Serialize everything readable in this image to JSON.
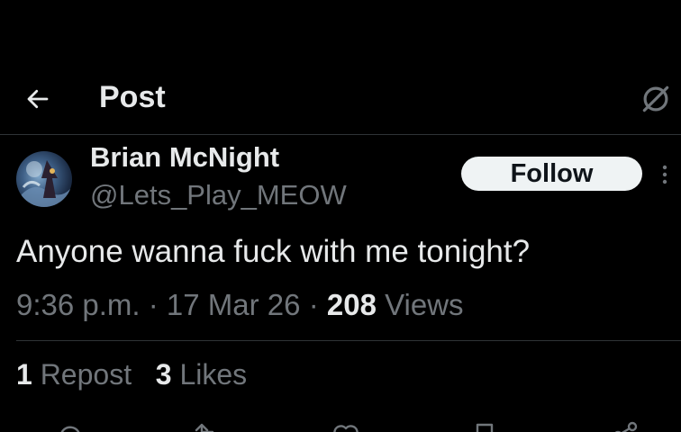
{
  "header": {
    "title": "Post"
  },
  "author": {
    "display_name": "Brian McNight",
    "handle": "@Lets_Play_MEOW",
    "follow_label": "Follow"
  },
  "post": {
    "text": "Anyone wanna fuck with me tonight?",
    "time": "9:36 p.m.",
    "separator": "·",
    "date": "17 Mar 26",
    "views_count": "208",
    "views_label": "Views"
  },
  "stats": {
    "reposts_count": "1",
    "reposts_label": "Repost",
    "likes_count": "3",
    "likes_label": "Likes"
  },
  "icons": {
    "back": "arrow-left-icon",
    "grok": "grok-icon",
    "more": "more-vertical-icon",
    "reply": "reply-icon",
    "repost": "repost-icon",
    "like": "heart-icon",
    "bookmark": "bookmark-icon",
    "share": "share-icon"
  },
  "colors": {
    "background": "#000000",
    "text_primary": "#e7e9ea",
    "text_secondary": "#71767b",
    "divider": "#2f3336",
    "follow_bg": "#eff3f4"
  }
}
